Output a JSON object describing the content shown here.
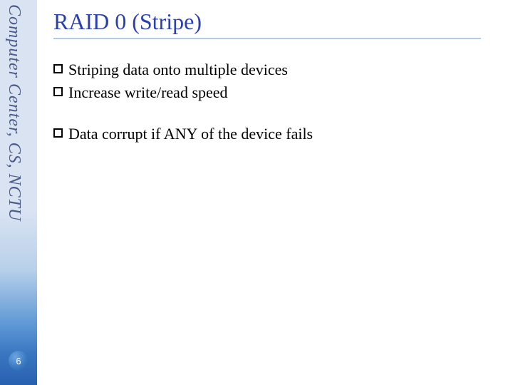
{
  "sidebar": {
    "vertical_label": "Computer Center, CS, NCTU",
    "page_number": "6"
  },
  "title": "RAID 0 (Stripe)",
  "group1": {
    "bullets": [
      "Striping data onto multiple devices",
      "Increase write/read speed"
    ]
  },
  "group2": {
    "bullets": [
      "Data corrupt if ANY of the device fails"
    ]
  }
}
